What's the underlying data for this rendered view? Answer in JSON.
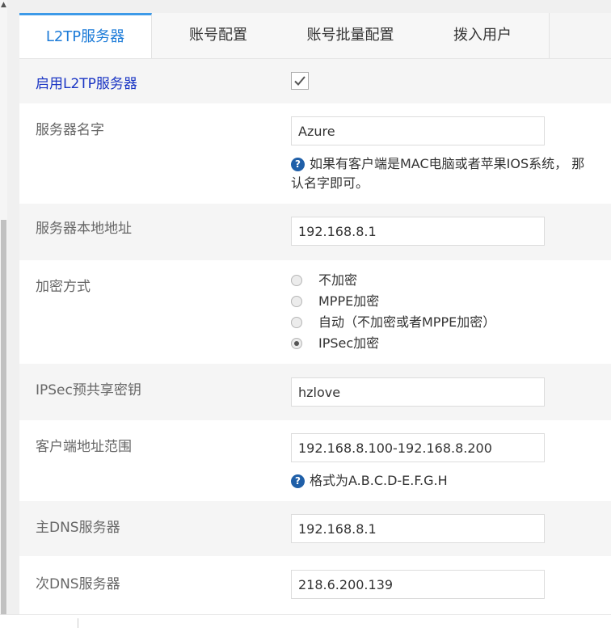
{
  "tabs": [
    {
      "label": "L2TP服务器",
      "active": true
    },
    {
      "label": "账号配置",
      "active": false
    },
    {
      "label": "账号批量配置",
      "active": false
    },
    {
      "label": "拨入用户",
      "active": false
    }
  ],
  "enable": {
    "label": "启用L2TP服务器",
    "checked": true
  },
  "server_name": {
    "label": "服务器名字",
    "value": "Azure",
    "help_line1": "如果有客户端是MAC电脑或者苹果IOS系统， 那",
    "help_line2": "认名字即可。"
  },
  "local_address": {
    "label": "服务器本地地址",
    "value": "192.168.8.1"
  },
  "encryption": {
    "label": "加密方式",
    "options": [
      "不加密",
      "MPPE加密",
      "自动（不加密或者MPPE加密）",
      "IPSec加密"
    ],
    "selected": "IPSec加密"
  },
  "ipsec_psk": {
    "label": "IPSec预共享密钥",
    "value": "hzlove"
  },
  "client_range": {
    "label": "客户端地址范围",
    "value": "192.168.8.100-192.168.8.200",
    "help": "格式为A.B.C.D-E.F.G.H"
  },
  "primary_dns": {
    "label": "主DNS服务器",
    "value": "192.168.8.1"
  },
  "secondary_dns": {
    "label": "次DNS服务器",
    "value": "218.6.200.139"
  },
  "colors": {
    "accent": "#1c7bd8",
    "tab_border": "#3d9ae8",
    "enable_label": "#1a35c4",
    "help_icon": "#1f5fa8"
  }
}
